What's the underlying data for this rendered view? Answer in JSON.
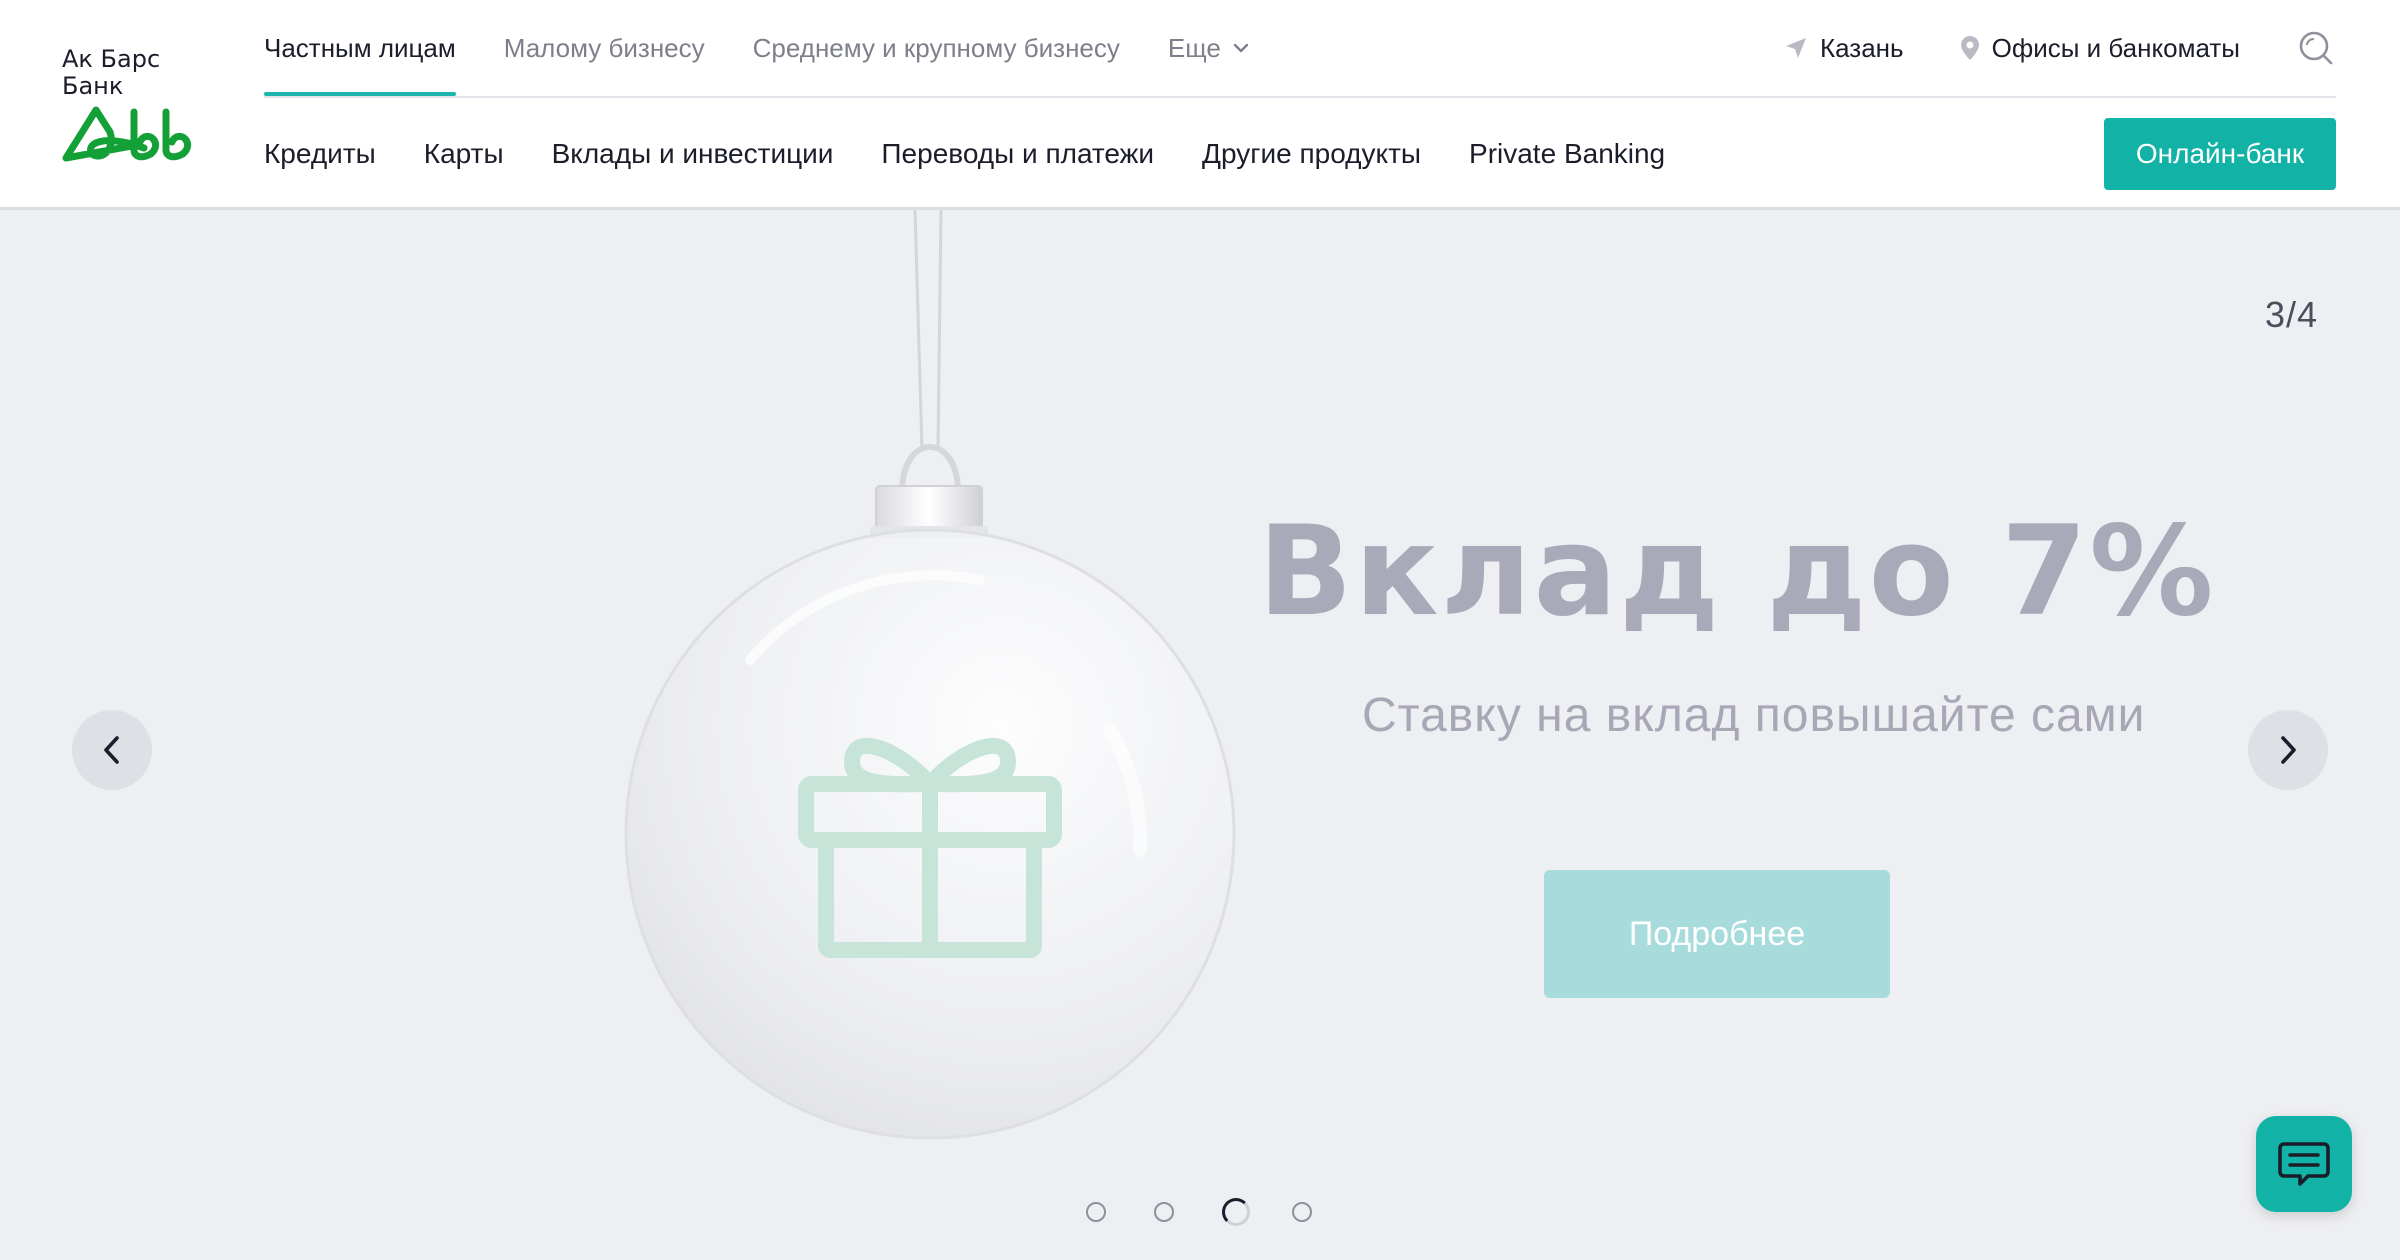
{
  "brand": {
    "line1": "Ак Барс",
    "line2": "Банк",
    "logo_icon": "akbars-logo-icon",
    "color": "#13a137"
  },
  "topnav": {
    "items": [
      {
        "label": "Частным лицам",
        "active": true
      },
      {
        "label": "Малому бизнесу",
        "active": false
      },
      {
        "label": "Среднему и крупному бизнесу",
        "active": false
      },
      {
        "label": "Еще",
        "active": false,
        "icon": "chevron-down-icon"
      }
    ]
  },
  "utils": {
    "city": "Казань",
    "city_icon": "location-arrow-icon",
    "offices": "Офисы и банкоматы",
    "offices_icon": "map-pin-icon",
    "search_icon": "search-icon"
  },
  "mainnav": {
    "items": [
      "Кредиты",
      "Карты",
      "Вклады и инвестиции",
      "Переводы и платежи",
      "Другие продукты",
      "Private Banking"
    ]
  },
  "online_bank": {
    "label": "Онлайн-банк",
    "color": "#12b3a6"
  },
  "hero": {
    "counter": "3/4",
    "headline": "Вклад до 7%",
    "subline": "Ставку на вклад повышайте сами",
    "cta": "Подробнее",
    "image_icons": [
      "christmas-ornament-icon",
      "gift-icon"
    ],
    "slides_total": 4,
    "slide_active": 3
  },
  "chat": {
    "icon": "chat-icon"
  },
  "colors": {
    "accent": "#12b3a6",
    "hero_bg": "#eeeff3",
    "headline": "#aaa9b9"
  }
}
